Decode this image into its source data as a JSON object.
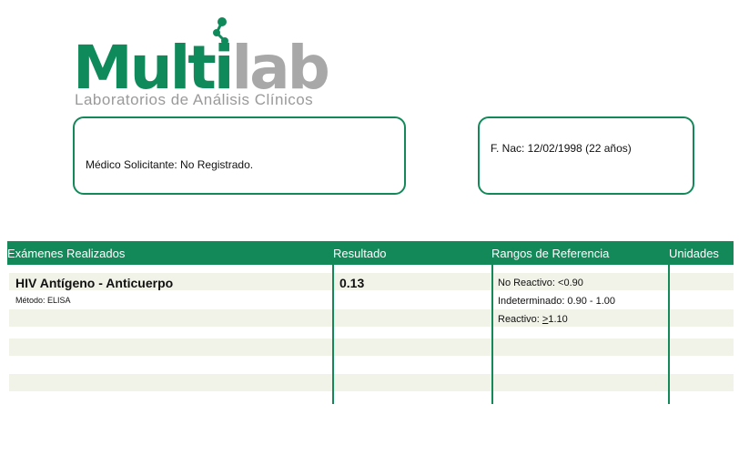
{
  "logo": {
    "name_part1": "Multi",
    "name_part2": "lab",
    "tagline": "Laboratorios de Análisis Clínicos",
    "colors": {
      "green": "#0f8a5a",
      "gray": "#a8a8a8"
    }
  },
  "patient": {
    "requesting_doctor": "Médico Solicitante: No Registrado.",
    "birth_date": "F. Nac: 12/02/1998 (22 años)"
  },
  "table": {
    "headers": {
      "exams": "Exámenes Realizados",
      "result": "Resultado",
      "reference": "Rangos de Referencia",
      "units": "Unidades"
    },
    "row": {
      "exam": "HIV Antígeno - Anticuerpo",
      "method": "Método: ELISA",
      "result": "0.13",
      "ref_nonreactive": "No Reactivo: <0.90",
      "ref_indeterminate": "Indeterminado: 0.90 - 1.00",
      "ref_reactive_prefix": "Reactivo: ",
      "ref_reactive_symbol": ">",
      "ref_reactive_value": "1.10"
    },
    "colors": {
      "header_bg": "#13895a",
      "band": "#f1f3e8"
    }
  }
}
